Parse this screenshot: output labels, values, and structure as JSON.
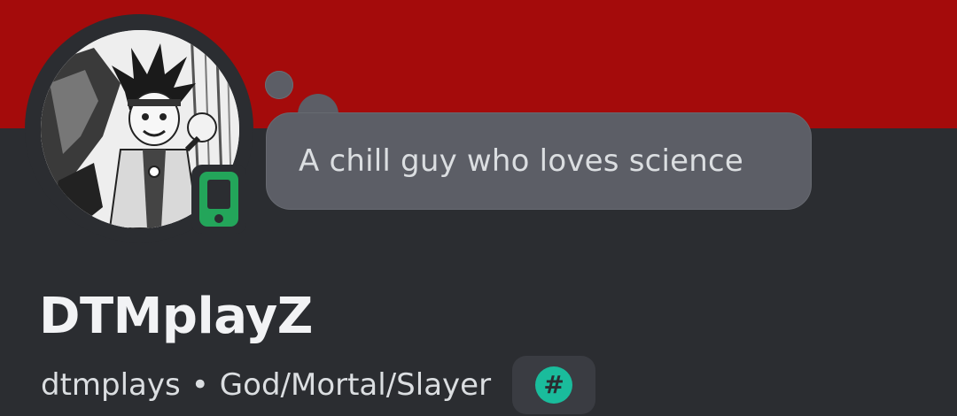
{
  "profile": {
    "banner_color": "#a40b0b",
    "avatar_icon": "anime-character-avatar",
    "status_icon": "mobile-phone-icon",
    "status_color": "#23a55a",
    "custom_status": "A chill guy who loves science",
    "display_name": "DTMplayZ",
    "username": "dtmplays",
    "separator": "•",
    "pronouns": "God/Mortal/Slayer",
    "badge_icon": "hashtag-icon",
    "badge_symbol": "#",
    "badge_color": "#1abc9c"
  }
}
